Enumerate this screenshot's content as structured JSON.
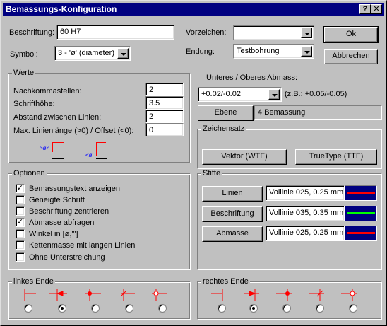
{
  "window": {
    "title": "Bemassungs-Konfiguration",
    "help_label": "?",
    "close_label": "✕"
  },
  "top": {
    "beschriftung_label": "Beschriftung:",
    "beschriftung_value": "60 H7",
    "symbol_label": "Symbol:",
    "symbol_value": "3 - 'ø' (diameter)",
    "vorzeichen_label": "Vorzeichen:",
    "vorzeichen_value": "",
    "endung_label": "Endung:",
    "endung_value": "Testbohrung",
    "ok_label": "Ok",
    "cancel_label": "Abbrechen"
  },
  "werte": {
    "title": "Werte",
    "rows": [
      {
        "label": "Nachkommastellen:",
        "value": "2"
      },
      {
        "label": "Schrifthöhe:",
        "value": "3.5"
      },
      {
        "label": "Abstand zwischen Linien:",
        "value": "2"
      },
      {
        "label": "Max. Linienlänge (>0) / Offset (<0):",
        "value": "0"
      }
    ],
    "icon1_text": ">ø<",
    "icon2_text": "<ø"
  },
  "abmass": {
    "label": "Unteres / Oberes Abmass:",
    "value": "+0.02/-0.02",
    "hint": "(z.B.: +0.05/-0.05)",
    "ebene_button": "Ebene",
    "ebene_value": "4 Bemassung"
  },
  "zeichensatz": {
    "title": "Zeichensatz",
    "vektor_button": "Vektor (WTF)",
    "truetype_button": "TrueType (TTF)"
  },
  "optionen": {
    "title": "Optionen",
    "items": [
      {
        "label": "Bemassungstext anzeigen",
        "checked": true
      },
      {
        "label": "Geneigte Schrift",
        "checked": false
      },
      {
        "label": "Beschriftung zentrieren",
        "checked": false
      },
      {
        "label": "Abmasse abfragen",
        "checked": true
      },
      {
        "label": "Winkel in [ø,'\"]",
        "checked": false
      },
      {
        "label": "Kettenmasse mit langen Linien",
        "checked": false
      },
      {
        "label": "Ohne Unterstreichung",
        "checked": false
      }
    ]
  },
  "stifte": {
    "title": "Stifte",
    "rows": [
      {
        "button": "Linien",
        "value": "Vollinie 025, 0.25 mm",
        "color": "#ff0000"
      },
      {
        "button": "Beschriftung",
        "value": "Vollinie 035, 0.35 mm",
        "color": "#00ff00"
      },
      {
        "button": "Abmasse",
        "value": "Vollinie 025, 0.25 mm",
        "color": "#ff0000"
      }
    ],
    "swatch_bg": "#000080"
  },
  "linkes_ende": {
    "title": "linkes Ende",
    "selected_index": 1,
    "options": [
      "stroke",
      "arrow",
      "dot",
      "slash",
      "circle"
    ]
  },
  "rechtes_ende": {
    "title": "rechtes Ende",
    "selected_index": 1,
    "options": [
      "stroke",
      "arrow",
      "dot",
      "slash",
      "circle"
    ]
  },
  "colors": {
    "title_bg": "#000080",
    "face": "#c0c0c0",
    "symbol_red": "#ff0000",
    "symbol_blue": "#0000ff"
  }
}
